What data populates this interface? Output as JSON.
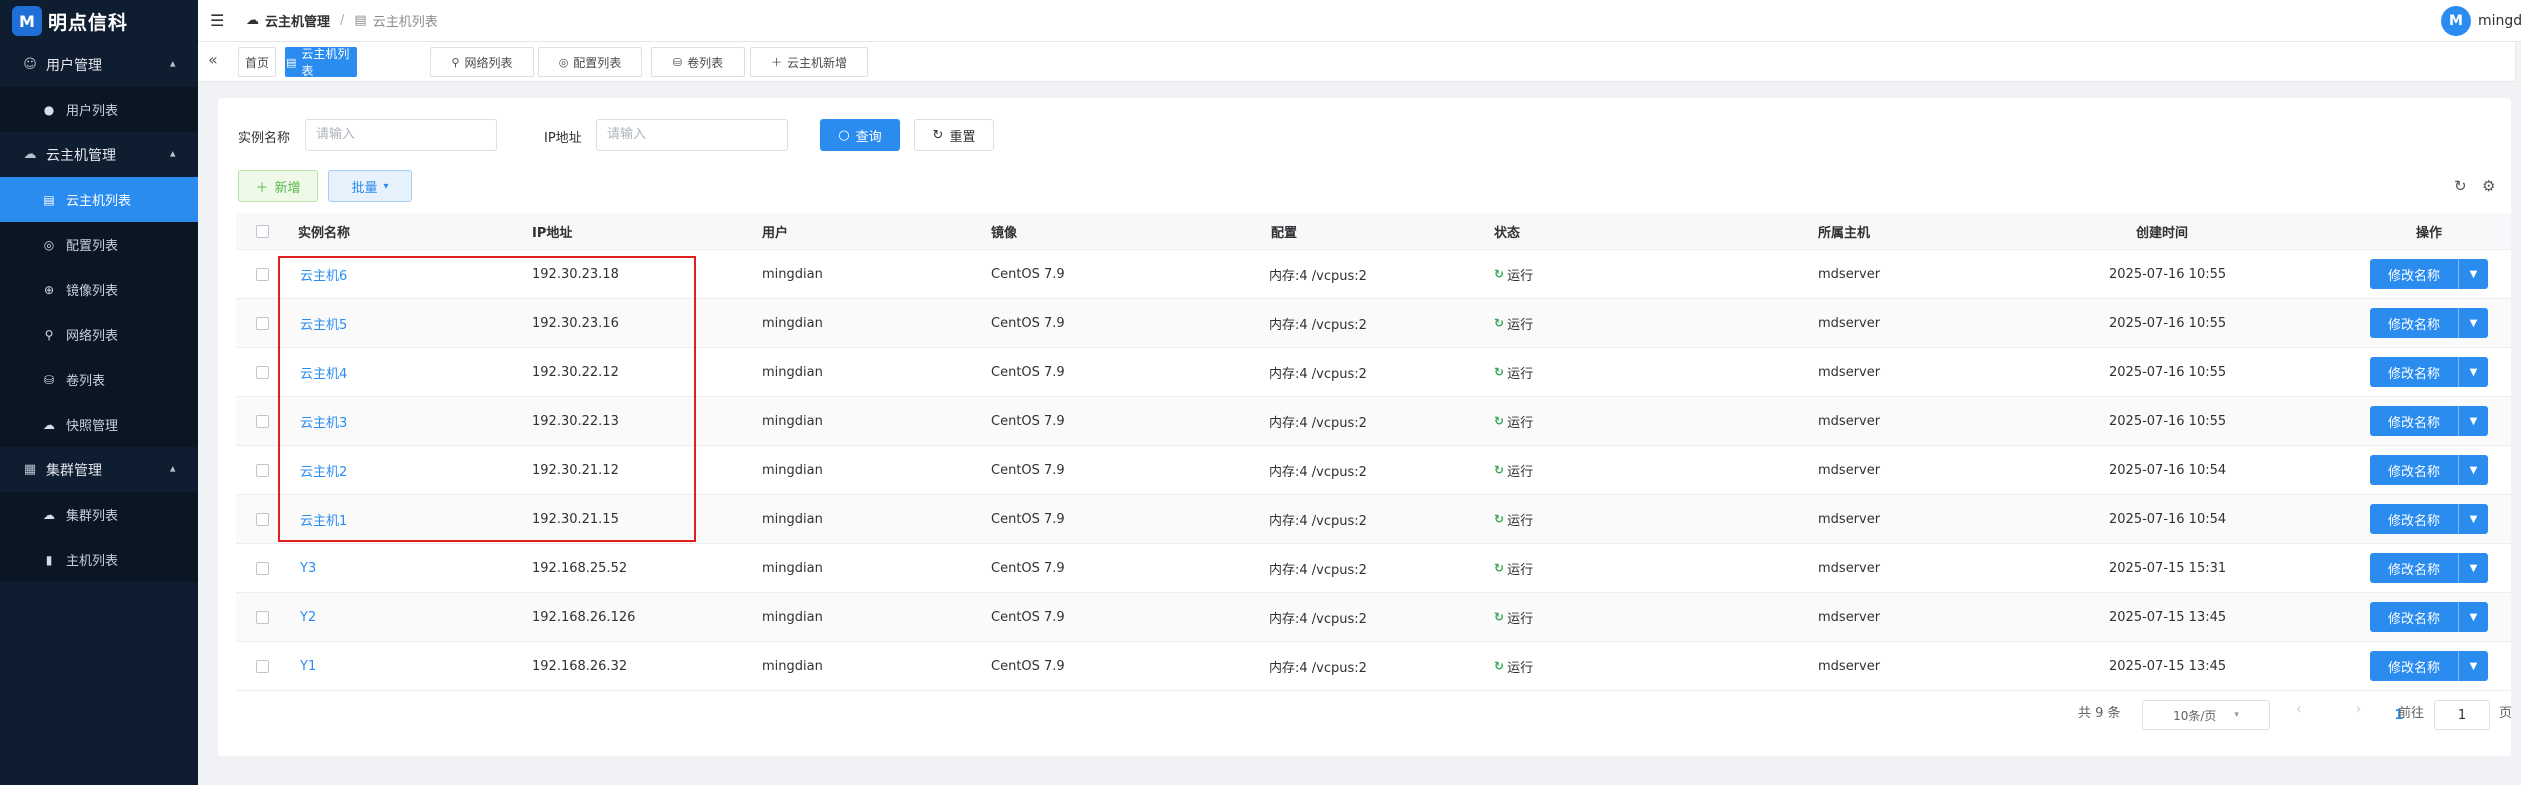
{
  "brand": {
    "logo_letter": "M",
    "name": "明点信科"
  },
  "sidebar": {
    "groups": [
      {
        "label": "用户管理",
        "items": [
          {
            "label": "用户列表"
          }
        ]
      },
      {
        "label": "云主机管理",
        "items": [
          {
            "label": "云主机列表"
          },
          {
            "label": "配置列表"
          },
          {
            "label": "镜像列表"
          },
          {
            "label": "网络列表"
          },
          {
            "label": "卷列表"
          },
          {
            "label": "快照管理"
          }
        ]
      },
      {
        "label": "集群管理",
        "items": [
          {
            "label": "集群列表"
          },
          {
            "label": "主机列表"
          }
        ]
      }
    ]
  },
  "header": {
    "breadcrumb": [
      "云主机管理",
      "云主机列表"
    ],
    "user": {
      "avatar_letter": "M",
      "name": "mingdian"
    }
  },
  "tabs": [
    {
      "label": "首页"
    },
    {
      "label": "云主机列表"
    },
    {
      "label": "网络列表"
    },
    {
      "label": "配置列表"
    },
    {
      "label": "卷列表"
    },
    {
      "label": "云主机新增"
    }
  ],
  "search": {
    "name_label": "实例名称",
    "name_placeholder": "请输入",
    "ip_label": "IP地址",
    "ip_placeholder": "请输入",
    "query_label": "查询",
    "reset_label": "重置"
  },
  "toolbar": {
    "add_label": "新增",
    "batch_label": "批量"
  },
  "table": {
    "columns": [
      "实例名称",
      "IP地址",
      "用户",
      "镜像",
      "配置",
      "状态",
      "所属主机",
      "创建时间",
      "操作"
    ],
    "rows": [
      {
        "name": "云主机6",
        "ip": "192.30.23.18",
        "user": "mingdian",
        "image": "CentOS 7.9",
        "config": "内存:4 /vcpus:2",
        "status": "运行",
        "host": "mdserver",
        "created": "2025-07-16 10:55",
        "action": "修改名称"
      },
      {
        "name": "云主机5",
        "ip": "192.30.23.16",
        "user": "mingdian",
        "image": "CentOS 7.9",
        "config": "内存:4 /vcpus:2",
        "status": "运行",
        "host": "mdserver",
        "created": "2025-07-16 10:55",
        "action": "修改名称"
      },
      {
        "name": "云主机4",
        "ip": "192.30.22.12",
        "user": "mingdian",
        "image": "CentOS 7.9",
        "config": "内存:4 /vcpus:2",
        "status": "运行",
        "host": "mdserver",
        "created": "2025-07-16 10:55",
        "action": "修改名称"
      },
      {
        "name": "云主机3",
        "ip": "192.30.22.13",
        "user": "mingdian",
        "image": "CentOS 7.9",
        "config": "内存:4 /vcpus:2",
        "status": "运行",
        "host": "mdserver",
        "created": "2025-07-16 10:55",
        "action": "修改名称"
      },
      {
        "name": "云主机2",
        "ip": "192.30.21.12",
        "user": "mingdian",
        "image": "CentOS 7.9",
        "config": "内存:4 /vcpus:2",
        "status": "运行",
        "host": "mdserver",
        "created": "2025-07-16 10:54",
        "action": "修改名称"
      },
      {
        "name": "云主机1",
        "ip": "192.30.21.15",
        "user": "mingdian",
        "image": "CentOS 7.9",
        "config": "内存:4 /vcpus:2",
        "status": "运行",
        "host": "mdserver",
        "created": "2025-07-16 10:54",
        "action": "修改名称"
      },
      {
        "name": "Y3",
        "ip": "192.168.25.52",
        "user": "mingdian",
        "image": "CentOS 7.9",
        "config": "内存:4 /vcpus:2",
        "status": "运行",
        "host": "mdserver",
        "created": "2025-07-15 15:31",
        "action": "修改名称"
      },
      {
        "name": "Y2",
        "ip": "192.168.26.126",
        "user": "mingdian",
        "image": "CentOS 7.9",
        "config": "内存:4 /vcpus:2",
        "status": "运行",
        "host": "mdserver",
        "created": "2025-07-15 13:45",
        "action": "修改名称"
      },
      {
        "name": "Y1",
        "ip": "192.168.26.32",
        "user": "mingdian",
        "image": "CentOS 7.9",
        "config": "内存:4 /vcpus:2",
        "status": "运行",
        "host": "mdserver",
        "created": "2025-07-15 13:45",
        "action": "修改名称"
      }
    ]
  },
  "pagination": {
    "total": "共 9 条",
    "page_size": "10条/页",
    "current_page": "1",
    "goto_label": "前往",
    "goto_value": "1",
    "page_suffix": "页"
  },
  "colors": {
    "primary": "#2b8cf0",
    "sidebar_bg": "#0f1d30",
    "status_running": "#3aa85a",
    "highlight": "#e02020"
  }
}
